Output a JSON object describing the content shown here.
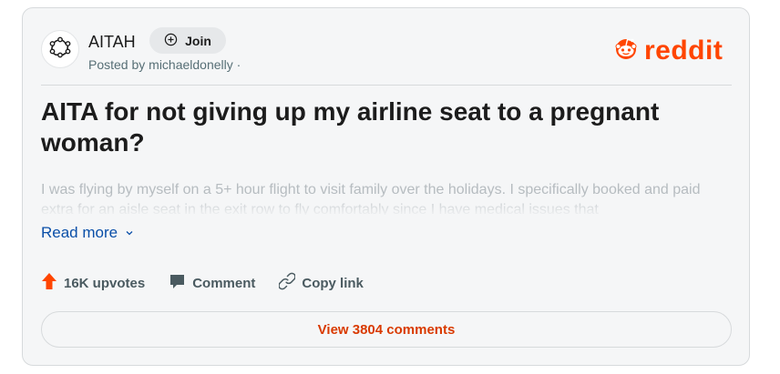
{
  "post": {
    "subreddit": "AITAH",
    "join_label": "Join",
    "posted_by": "Posted by michaeldonelly ·",
    "title": "AITA for not giving up my airline seat to a pregnant woman?",
    "body_preview": "I was flying by myself on a 5+ hour flight to visit family over the holidays. I specifically booked and paid extra for an aisle seat in the exit row to fly comfortably since I have medical issues that",
    "read_more": "Read more",
    "upvotes": "16K upvotes",
    "comment_label": "Comment",
    "copy_link_label": "Copy link",
    "view_comments": "View 3804 comments"
  },
  "brand": {
    "logo_text": "reddit",
    "color": "#ff4500"
  },
  "icons": {
    "avatar": "subreddit-avatar-icon",
    "join": "plus-circle-icon",
    "upvote": "upvote-arrow-icon",
    "comment": "comment-bubble-icon",
    "link": "link-icon",
    "chevron": "chevron-down-icon",
    "logo": "reddit-snoo-icon"
  }
}
